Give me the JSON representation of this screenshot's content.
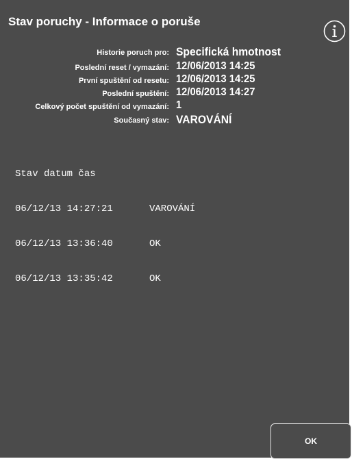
{
  "dialog": {
    "title": "Stav poruchy - Informace o poruše",
    "info_icon": "info-icon"
  },
  "info": {
    "rows": [
      {
        "label": "Historie poruch pro:",
        "value": "Specifická hmotnost"
      },
      {
        "label": "Poslední reset / vymazání:",
        "value": "12/06/2013 14:25"
      },
      {
        "label": "První spuštění od resetu:",
        "value": "12/06/2013 14:25"
      },
      {
        "label": "Poslední spuštění:",
        "value": "12/06/2013 14:27"
      },
      {
        "label": "Celkový počet spuštění od vymazání:",
        "value": "1"
      },
      {
        "label": "Současný stav:",
        "value": "VAROVÁNÍ"
      }
    ]
  },
  "log": {
    "header": "Stav datum čas",
    "entries": [
      {
        "time": "06/12/13 14:27:21",
        "status": "VAROVÁNÍ"
      },
      {
        "time": "06/12/13 13:36:40",
        "status": "OK"
      },
      {
        "time": "06/12/13 13:35:42",
        "status": "OK"
      }
    ]
  },
  "buttons": {
    "ok_label": "OK"
  },
  "colors": {
    "background": "#4b4b4b",
    "text": "#ffffff",
    "button_border": "#e8e8e8"
  }
}
